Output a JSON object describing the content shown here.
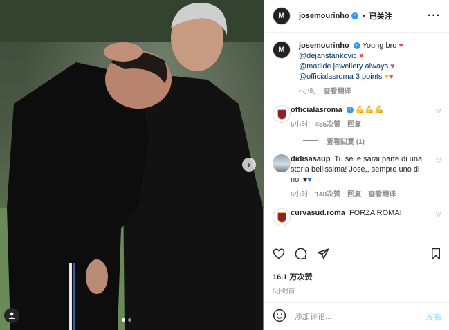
{
  "post": {
    "author": "josemourinho",
    "author_initial": "M",
    "follow_status": "已关注",
    "caption_lines": [
      "Young bro",
      "@dejanstankovic",
      "@matilde.jewellery always",
      "@officialasroma 3 points"
    ],
    "caption_time": "6小时",
    "see_translation": "查看翻译",
    "likes": "16.1 万次赞",
    "posted_ago": "6小时前"
  },
  "comments": [
    {
      "user": "officialasroma",
      "text": "💪💪💪",
      "time": "6小时",
      "likes": "455次赞",
      "reply": "回复",
      "view_replies": "查看回复 (1)"
    },
    {
      "user": "didisasaup",
      "text": "Tu sei e sarai parte di una storia bellissima! Jose,, sempre uno di noi",
      "time": "6小时",
      "likes": "140次赞",
      "reply": "回复",
      "see_translation": "查看翻译"
    },
    {
      "user": "curvasud.roma",
      "text": "FORZA ROMA!"
    }
  ],
  "comment_box": {
    "placeholder": "添加评论...",
    "post_label": "发布"
  },
  "icons": {
    "more": "more-options-icon",
    "heart": "heart-icon",
    "comment": "comment-icon",
    "share": "share-icon",
    "save": "bookmark-icon",
    "emoji": "emoji-icon",
    "tag": "user-tag-icon",
    "next": "carousel-next-icon"
  },
  "colors": {
    "verified": "#3897f0",
    "mention": "#00376b",
    "post_button": "#b2dffc"
  }
}
